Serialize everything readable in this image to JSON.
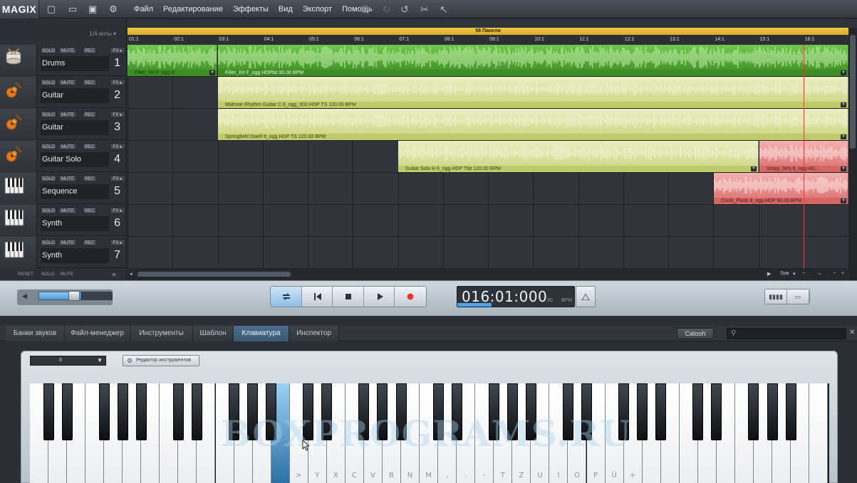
{
  "app": {
    "logo": "MAGIX"
  },
  "menu": [
    "Файл",
    "Редактирование",
    "Эффекты",
    "Вид",
    "Экспорт",
    "Помощь"
  ],
  "arranger": {
    "quantize": "1/4 ноты",
    "marker_label": "58 Панели",
    "bars": [
      "01:1",
      "02:1",
      "03:1",
      "04:1",
      "05:1",
      "06:1",
      "07:1",
      "08:1",
      "09:1",
      "10:1",
      "11:1",
      "12:1",
      "13:1",
      "14:1",
      "15:1",
      "16:1"
    ],
    "track_buttons": {
      "solo": "SOLO",
      "mute": "MUTE",
      "rec": "REC",
      "fx": "FX ▸"
    },
    "tracks": [
      {
        "name": "Drums",
        "number": "1",
        "icon": "drum-icon"
      },
      {
        "name": "Guitar",
        "number": "2",
        "icon": "guitar-icon"
      },
      {
        "name": "Guitar",
        "number": "3",
        "icon": "guitar-icon"
      },
      {
        "name": "Guitar Solo",
        "number": "4",
        "icon": "guitar-icon"
      },
      {
        "name": "Sequence",
        "number": "5",
        "icon": "piano-icon"
      },
      {
        "name": "Synth",
        "number": "6",
        "icon": "piano-icon"
      },
      {
        "name": "Synth",
        "number": "7",
        "icon": "piano-icon"
      }
    ],
    "clips": [
      {
        "label": "Filter_Kit F_ogg.H"
      },
      {
        "label": "Filter_Kit F_ogg.HDPbit   90.00 BPM"
      },
      {
        "label": "Malmoe Rhythm Guitar C 6_ogg_002.HDP  TS  120.00 BPM"
      },
      {
        "label": "Springfield Dwell 6_ogg.HDP  TS  120.00 BPM"
      },
      {
        "label": "Guitar Solo H 6_ogg.HDP  Tbit   120.00 BPM"
      },
      {
        "label": "Stopp_Seq 6_ogg.HD..."
      },
      {
        "label": "Clock_Pluck 6_ogg.HDP  90.00 BPM"
      }
    ],
    "footer": {
      "reset": "RESET",
      "solo": "SOLO",
      "mute": "MUTE"
    },
    "zoom_label": "Зум"
  },
  "transport": {
    "time": "016:01:000",
    "bpm_value": "90",
    "bpm_label": "BPM"
  },
  "lower": {
    "tabs": [
      "Банки звуков",
      "Файл-менеджер",
      "Инструменты",
      "Шаблон",
      "Клавиатура",
      "Инспектор"
    ],
    "active_tab": "Клавиатура",
    "catooh": "Catooh",
    "instrument_select": "8",
    "instrument_editor": "Редактор инструментов",
    "key_labels": [
      ">",
      "Y",
      "X",
      "C",
      "V",
      "B",
      "N",
      "M",
      ",",
      ".",
      "-",
      "T",
      "Z",
      "U",
      "I",
      "O",
      "P",
      "Ü",
      "+"
    ]
  },
  "watermark": "BOXPROGRAMS.RU",
  "colors": {
    "drums_clip": "#57b02c",
    "guitar_clip": "#d8e09a",
    "pink_clip": "#e58f8f",
    "marker": "#e6b930",
    "accent": "#4da6e8"
  }
}
